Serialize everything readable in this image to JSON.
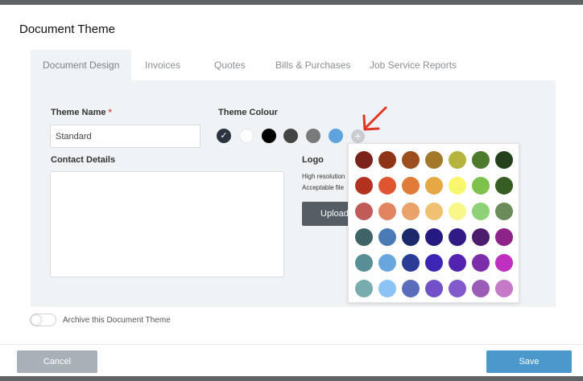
{
  "dialog": {
    "title": "Document Theme"
  },
  "tabs": [
    {
      "label": "Document Design",
      "active": true
    },
    {
      "label": "Invoices"
    },
    {
      "label": "Quotes"
    },
    {
      "label": "Bills & Purchases"
    },
    {
      "label": "Job Service Reports"
    }
  ],
  "theme_name": {
    "label": "Theme Name",
    "required_mark": "*",
    "value": "Standard"
  },
  "theme_colour": {
    "label": "Theme Colour",
    "selected_index": 0,
    "check_glyph": "✓",
    "add_glyph": "+",
    "swatches": [
      "#2c3441",
      "#ffffff",
      "#000000",
      "#444444",
      "#7a7a7a",
      "#5fa3dd"
    ]
  },
  "palette": {
    "rows": [
      [
        "#7c241c",
        "#8f3517",
        "#9b4f1d",
        "#a2782a",
        "#b7b43d",
        "#4d7b2c",
        "#24401a"
      ],
      [
        "#b2321f",
        "#de5530",
        "#e07c38",
        "#e6a745",
        "#f7f66c",
        "#7ec24c",
        "#365e22"
      ],
      [
        "#c05b58",
        "#e08560",
        "#e9a268",
        "#f0c170",
        "#f9f68a",
        "#8ed278",
        "#6a8c5a"
      ],
      [
        "#3e6468",
        "#4a7ab5",
        "#1a2a6a",
        "#251a80",
        "#2f1a86",
        "#4c1c6d",
        "#8d2288"
      ],
      [
        "#578f94",
        "#6aa6de",
        "#2b3c96",
        "#3b25b4",
        "#5224b0",
        "#7b2daa",
        "#c030bf"
      ],
      [
        "#78acaf",
        "#8ac4f4",
        "#5c6cbc",
        "#7250c8",
        "#8159cd",
        "#9b5cb8",
        "#c57ac8"
      ]
    ]
  },
  "contact": {
    "label": "Contact Details",
    "value": ""
  },
  "logo": {
    "label": "Logo",
    "hint_line1": "High resolution",
    "hint_line2": "Acceptable file",
    "upload_label": "Upload"
  },
  "archive": {
    "label": "Archive this Document Theme",
    "enabled": false
  },
  "footer": {
    "cancel_label": "Cancel",
    "save_label": "Save"
  },
  "colors": {
    "arrow": "#e03527",
    "save": "#4a98cc",
    "cancel": "#a8b0b8"
  }
}
